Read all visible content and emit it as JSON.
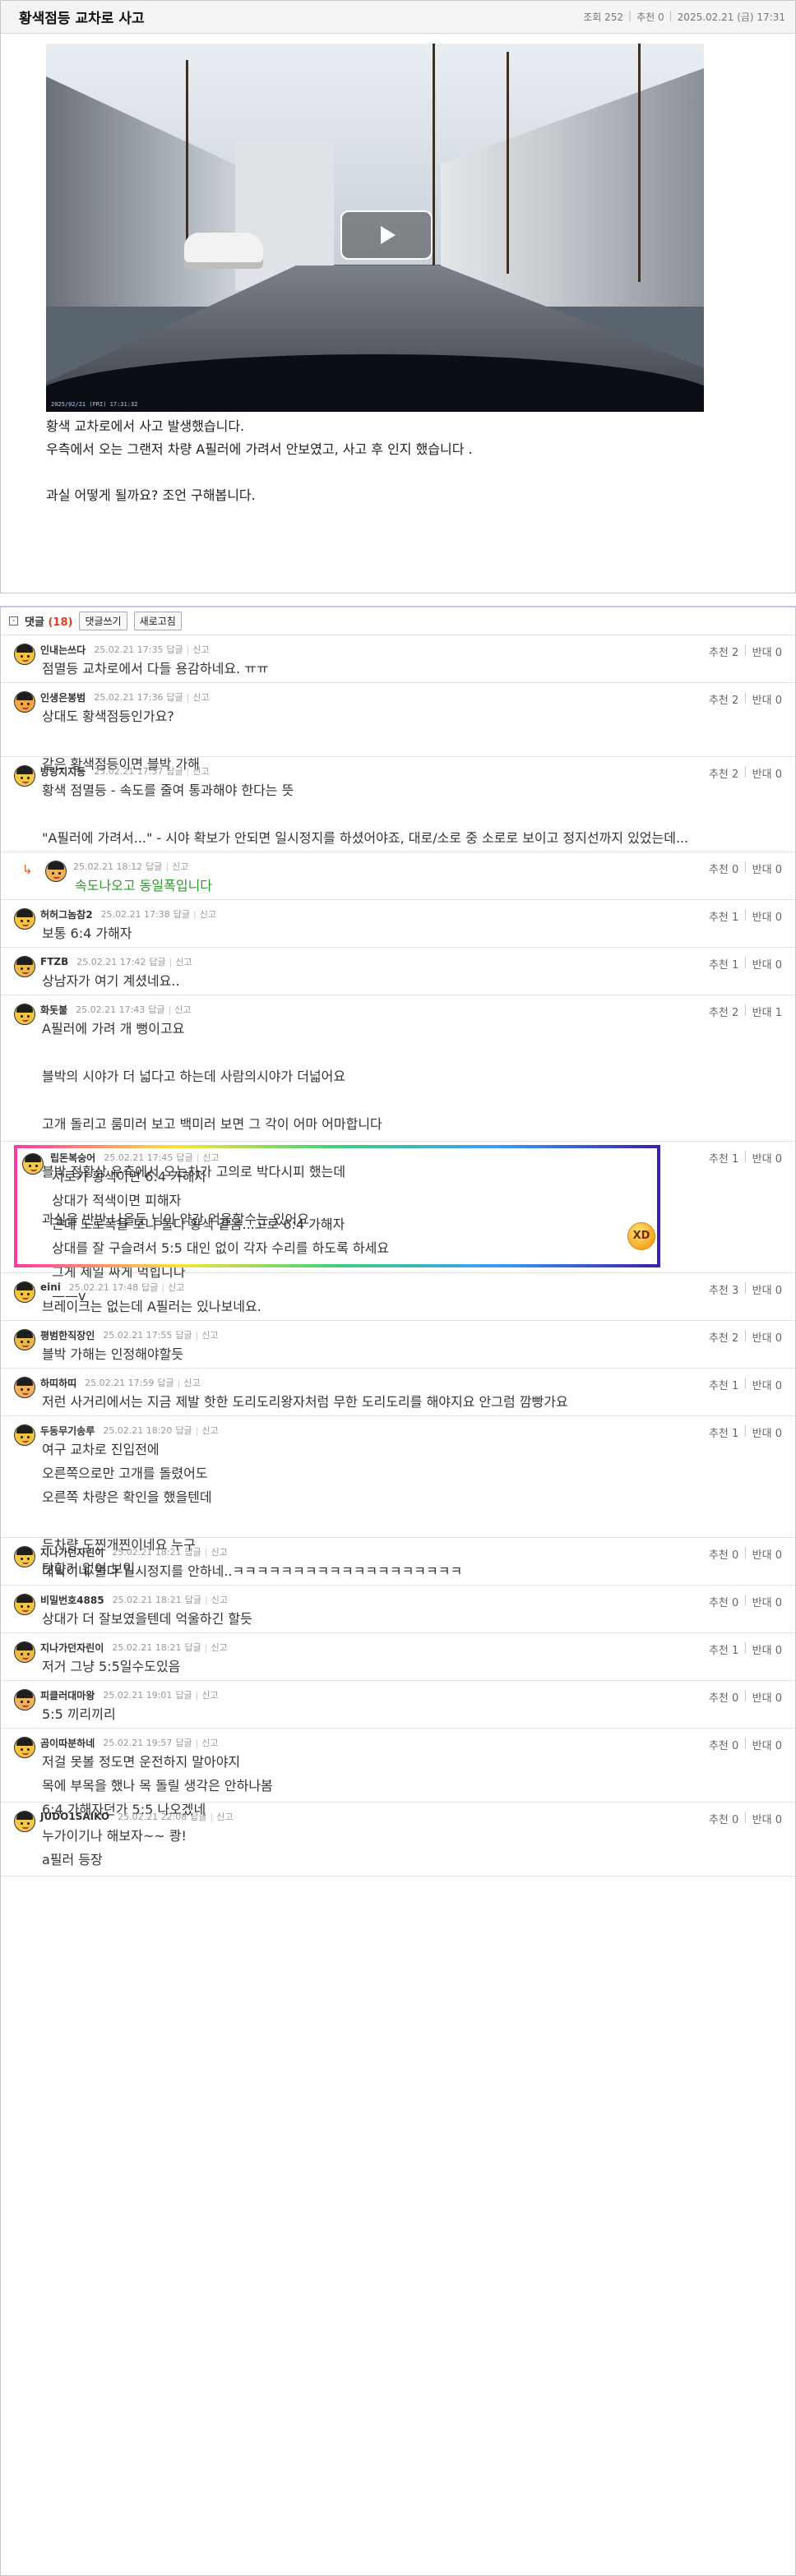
{
  "post": {
    "title": "황색점등 교차로 사고",
    "views": "조회 252",
    "recommend": "추천 0",
    "datetime": "2025.02.21 (금) 17:31",
    "video_stamp": "2025/02/21 (FRI) 17:31:32",
    "body": [
      "황색 교차로에서 사고 발생했습니다.",
      "우측에서 오는 그랜저 차량 A필러에 가려서 안보였고, 사고 후 인지 했습니다 .",
      "",
      "과실 어떻게 될까요? 조언 구해봅니다."
    ]
  },
  "comments_bar": {
    "toggle": "-",
    "label": "댓글",
    "count": "(18)",
    "write_button": "댓글쓰기",
    "refresh_button": "새로고침"
  },
  "comments": [
    {
      "nick": "인내는쓰다",
      "date": "25.02.21 17:35",
      "reply": "답글",
      "report": "신고",
      "up": "추천 2",
      "down": "반대 0",
      "lines": [
        "점멸등 교차로에서 다들 용감하네요. ㅠㅠ"
      ]
    },
    {
      "nick": "인생은봉범",
      "date": "25.02.21 17:36",
      "reply": "답글",
      "report": "신고",
      "up": "추천 2",
      "down": "반대 0",
      "lines": [
        "상대도 황색점등인가요?",
        "",
        "같은 황색점등이면 블박 가해"
      ]
    },
    {
      "nick": "방랑지지등",
      "date": "25.02.21 17:37",
      "reply": "답글",
      "report": "신고",
      "up": "추천 2",
      "down": "반대 0",
      "lines": [
        "황색 점멸등 - 속도를 줄여 통과해야 한다는 뜻",
        "",
        "\"A필러에 가려서...\" - 시야 확보가 안되면 일시정지를 하셨어야죠, 대로/소로 중 소로로 보이고 정지선까지 있었는데..."
      ]
    },
    {
      "nick": "",
      "date": "25.02.21 18:12",
      "reply": "답글",
      "report": "신고",
      "up": "추천 0",
      "down": "반대 0",
      "lines": [
        "속도나오고 동일폭입니다"
      ]
    },
    {
      "nick": "허허그놈참2",
      "date": "25.02.21 17:38",
      "reply": "답글",
      "report": "신고",
      "up": "추천 1",
      "down": "반대 0",
      "lines": [
        "보통 6:4 가해자"
      ]
    },
    {
      "nick": "FTZB",
      "date": "25.02.21 17:42",
      "reply": "답글",
      "report": "신고",
      "up": "추천 1",
      "down": "반대 0",
      "lines": [
        "상남자가 여기 계셨네요.."
      ]
    },
    {
      "nick": "화돗불",
      "date": "25.02.21 17:43",
      "reply": "답글",
      "report": "신고",
      "up": "추천 2",
      "down": "반대 1",
      "lines": [
        "A필러에 가려 개 뻥이고요",
        "",
        "블박의 시야가 더 넓다고 하는데 사람의시야가 더넓어요",
        "",
        "고개 돌리고 룸미러 보고 백미러 보면 그 각이 어마 어마합니다",
        "",
        "블박 정황상 우측에서 오는차가 고의로 박다시피 했는데",
        "",
        "과실을 반반 나올듯 님이 약간 억울할수는 있어요"
      ]
    },
    {
      "nick": "립돈복숭어",
      "date": "25.02.21 17:45",
      "reply": "답글",
      "report": "신고",
      "up": "추천 1",
      "down": "반대 0",
      "lines": [
        "서로가 황색이면 6:4 가해자",
        "상대가 적색이면 피해자",
        "근데 도로폭을 보니 둘다 황색 같음...고로 6:4 가해자",
        "상대를 잘 구슬려서 5:5 대인 없이 각자 수리를 하도록 하세요",
        "그게 제일 싸게 먹힙니다",
        "——v"
      ]
    },
    {
      "nick": "eini",
      "date": "25.02.21 17:48",
      "reply": "답글",
      "report": "신고",
      "up": "추천 3",
      "down": "반대 0",
      "lines": [
        "브레이크는 없는데 A필러는 있나보네요."
      ]
    },
    {
      "nick": "평범한직장인",
      "date": "25.02.21 17:55",
      "reply": "답글",
      "report": "신고",
      "up": "추천 2",
      "down": "반대 0",
      "lines": [
        "블박 가해는 인정해야할듯"
      ]
    },
    {
      "nick": "하띠하띠",
      "date": "25.02.21 17:59",
      "reply": "답글",
      "report": "신고",
      "up": "추천 1",
      "down": "반대 0",
      "lines": [
        "저런 사거리에서는 지금 제발 핫한 도리도리왕자처럼 무한 도리도리를 해야지요 안그럼 깜빵가요"
      ]
    },
    {
      "nick": "두동무기송루",
      "date": "25.02.21 18:20",
      "reply": "답글",
      "report": "신고",
      "up": "추천 1",
      "down": "반대 0",
      "lines": [
        "여구 교차로 진입전에",
        "오른쪽으로만 고개를 돌렸어도",
        "오른쪽 차량은 확인을 했을텐데",
        "",
        "두차량 도찐개찐이네요 누구",
        "탓할거 없어 보임"
      ]
    },
    {
      "nick": "지나가던자린이",
      "date": "25.02.21 18:21",
      "reply": "답글",
      "report": "신고",
      "up": "추천 0",
      "down": "반대 0",
      "lines": [
        "대박이네 둘다 일시정지를 안하네..ㅋㅋㅋㅋㅋㅋㅋㅋㅋㅋㅋㅋㅋㅋㅋㅋㅋㅋㅋ"
      ]
    },
    {
      "nick": "비밀번호4885",
      "date": "25.02.21 18:21",
      "reply": "답글",
      "report": "신고",
      "up": "추천 0",
      "down": "반대 0",
      "lines": [
        "상대가 더 잘보였을텐데 억울하긴 할듯"
      ]
    },
    {
      "nick": "지나가던자린이",
      "date": "25.02.21 18:21",
      "reply": "답글",
      "report": "신고",
      "up": "추천 1",
      "down": "반대 0",
      "lines": [
        "저거 그냥 5:5일수도있음"
      ]
    },
    {
      "nick": "피클러대마왕",
      "date": "25.02.21 19:01",
      "reply": "답글",
      "report": "신고",
      "up": "추천 0",
      "down": "반대 0",
      "lines": [
        "5:5 끼리끼리"
      ]
    },
    {
      "nick": "곰이따분하네",
      "date": "25.02.21 19:57",
      "reply": "답글",
      "report": "신고",
      "up": "추천 0",
      "down": "반대 0",
      "lines": [
        "저걸 못볼 정도면 운전하지 말아야지",
        "목에 부목을 했나 목 돌릴 생각은 안하나봄",
        "6:4 가해자던가 5:5 나오겠네"
      ]
    },
    {
      "nick": "JUDO1SAIKO",
      "date": "25.02.21 22:08",
      "reply": "답글",
      "report": "신고",
      "up": "추천 0",
      "down": "반대 0",
      "lines": [
        "누가이기나 해보자~~ 쾅!",
        "a필러 등장"
      ]
    }
  ]
}
